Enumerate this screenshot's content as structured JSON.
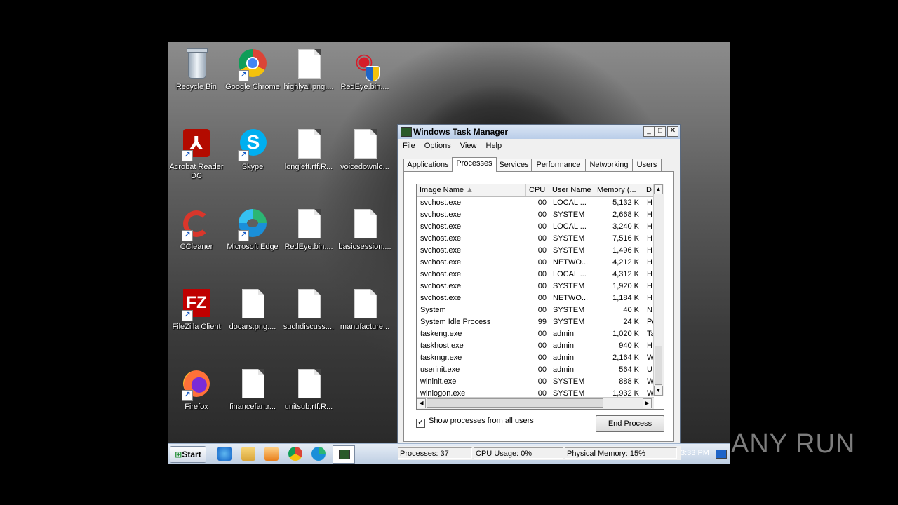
{
  "desktop": {
    "icons": [
      {
        "label": "Recycle Bin",
        "icon": "recycle-bin-icon"
      },
      {
        "label": "Google Chrome",
        "icon": "chrome-icon"
      },
      {
        "label": "highlyal.png....",
        "icon": "document-icon"
      },
      {
        "label": "RedEye.bin....",
        "icon": "redeye-icon"
      },
      {
        "label": "Acrobat Reader DC",
        "icon": "acrobat-icon"
      },
      {
        "label": "Skype",
        "icon": "skype-icon"
      },
      {
        "label": "longleft.rtf.R...",
        "icon": "document-icon"
      },
      {
        "label": "voicedownlo...",
        "icon": "document-icon"
      },
      {
        "label": "CCleaner",
        "icon": "ccleaner-icon"
      },
      {
        "label": "Microsoft Edge",
        "icon": "edge-icon"
      },
      {
        "label": "RedEye.bin....",
        "icon": "document-icon"
      },
      {
        "label": "basicsession....",
        "icon": "document-icon"
      },
      {
        "label": "FileZilla Client",
        "icon": "filezilla-icon"
      },
      {
        "label": "docars.png....",
        "icon": "document-icon"
      },
      {
        "label": "suchdiscuss....",
        "icon": "document-icon"
      },
      {
        "label": "manufacture...",
        "icon": "document-icon"
      },
      {
        "label": "Firefox",
        "icon": "firefox-icon"
      },
      {
        "label": "financefan.r...",
        "icon": "document-icon"
      },
      {
        "label": "unitsub.rtf.R...",
        "icon": "document-icon"
      }
    ]
  },
  "task_manager": {
    "title": "Windows Task Manager",
    "menu": [
      "File",
      "Options",
      "View",
      "Help"
    ],
    "tabs": [
      "Applications",
      "Processes",
      "Services",
      "Performance",
      "Networking",
      "Users"
    ],
    "active_tab": "Processes",
    "columns": [
      "Image Name",
      "CPU",
      "User Name",
      "Memory (...",
      "D"
    ],
    "rows": [
      {
        "name": "svchost.exe",
        "cpu": "00",
        "user": "LOCAL ...",
        "mem": "5,132 K",
        "d": "H"
      },
      {
        "name": "svchost.exe",
        "cpu": "00",
        "user": "SYSTEM",
        "mem": "2,668 K",
        "d": "H"
      },
      {
        "name": "svchost.exe",
        "cpu": "00",
        "user": "LOCAL ...",
        "mem": "3,240 K",
        "d": "H"
      },
      {
        "name": "svchost.exe",
        "cpu": "00",
        "user": "SYSTEM",
        "mem": "7,516 K",
        "d": "H"
      },
      {
        "name": "svchost.exe",
        "cpu": "00",
        "user": "SYSTEM",
        "mem": "1,496 K",
        "d": "H"
      },
      {
        "name": "svchost.exe",
        "cpu": "00",
        "user": "NETWO...",
        "mem": "4,212 K",
        "d": "H"
      },
      {
        "name": "svchost.exe",
        "cpu": "00",
        "user": "LOCAL ...",
        "mem": "4,312 K",
        "d": "H"
      },
      {
        "name": "svchost.exe",
        "cpu": "00",
        "user": "SYSTEM",
        "mem": "1,920 K",
        "d": "H"
      },
      {
        "name": "svchost.exe",
        "cpu": "00",
        "user": "NETWO...",
        "mem": "1,184 K",
        "d": "H"
      },
      {
        "name": "System",
        "cpu": "00",
        "user": "SYSTEM",
        "mem": "40 K",
        "d": "N"
      },
      {
        "name": "System Idle Process",
        "cpu": "99",
        "user": "SYSTEM",
        "mem": "24 K",
        "d": "Pe"
      },
      {
        "name": "taskeng.exe",
        "cpu": "00",
        "user": "admin",
        "mem": "1,020 K",
        "d": "Ta"
      },
      {
        "name": "taskhost.exe",
        "cpu": "00",
        "user": "admin",
        "mem": "940 K",
        "d": "H"
      },
      {
        "name": "taskmgr.exe",
        "cpu": "00",
        "user": "admin",
        "mem": "2,164 K",
        "d": "W"
      },
      {
        "name": "userinit.exe",
        "cpu": "00",
        "user": "admin",
        "mem": "564 K",
        "d": "U"
      },
      {
        "name": "wininit.exe",
        "cpu": "00",
        "user": "SYSTEM",
        "mem": "888 K",
        "d": "W"
      },
      {
        "name": "winlogon.exe",
        "cpu": "00",
        "user": "SYSTEM",
        "mem": "1,932 K",
        "d": "W"
      }
    ],
    "show_all_label": "Show processes from all users",
    "show_all_checked": true,
    "end_process_label": "End Process",
    "status": {
      "processes": "Processes: 37",
      "cpu": "CPU Usage: 0%",
      "memory": "Physical Memory: 15%"
    }
  },
  "taskbar": {
    "start_label": "Start",
    "clock": "3:33 PM"
  },
  "watermark": "ANY RUN"
}
